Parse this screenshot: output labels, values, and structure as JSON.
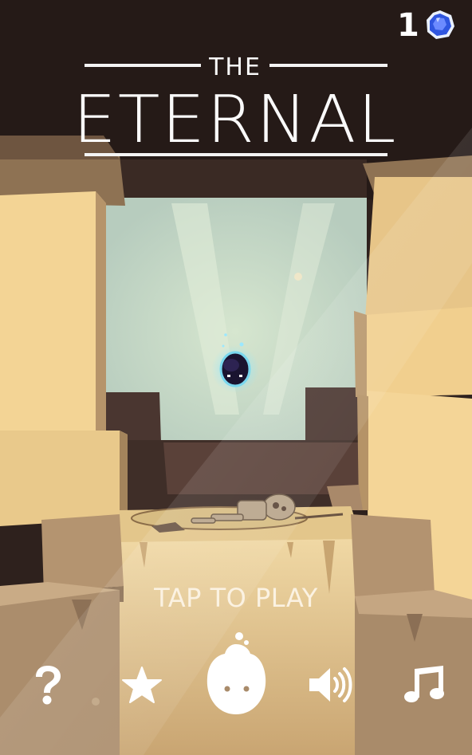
{
  "hud": {
    "gem_count": "1",
    "gem_icon": "blue-gem-icon"
  },
  "title": {
    "small": "THE",
    "main": "ETERNAL"
  },
  "prompt": {
    "tap_label": "TAP TO PLAY"
  },
  "toolbar": {
    "buttons": [
      {
        "icon": "help-question-icon"
      },
      {
        "icon": "star-icon"
      },
      {
        "icon": "character-skins-icon"
      },
      {
        "icon": "sound-speaker-icon"
      },
      {
        "icon": "music-note-icon"
      }
    ]
  },
  "colors": {
    "sky": "#c9ddc6",
    "cave_shadow": "#3b2b27",
    "sand_light": "#f2d08e",
    "sand_mid": "#d7ae70",
    "sand_dark": "#a3845d",
    "gem_blue": "#3a5ee8",
    "text": "#ffffff"
  }
}
